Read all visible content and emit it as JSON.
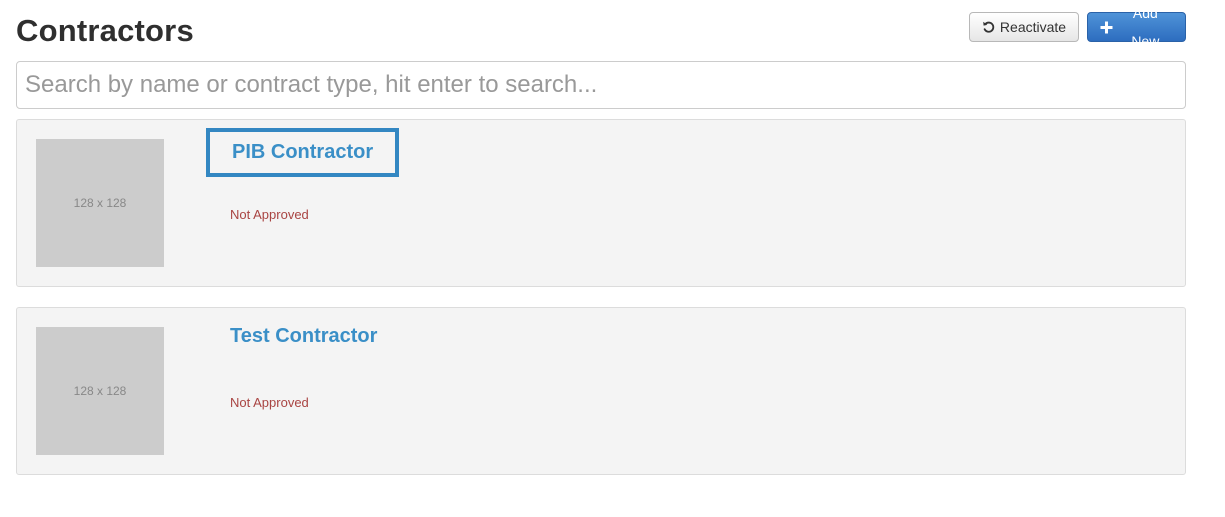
{
  "header": {
    "title": "Contractors",
    "reactivate_label": "Reactivate",
    "reactivate_icon": "undo-icon",
    "add_new_label": "Add New",
    "add_new_icon": "plus-icon"
  },
  "search": {
    "placeholder": "Search by name or contract type, hit enter to search...",
    "value": ""
  },
  "contractors": [
    {
      "name": "PIB Contractor",
      "thumbnail_text": "128 x 128",
      "status": "Not Approved",
      "highlighted": true
    },
    {
      "name": "Test Contractor",
      "thumbnail_text": "128 x 128",
      "status": "Not Approved",
      "highlighted": false
    }
  ],
  "colors": {
    "link": "#3a8fc7",
    "status_not_approved": "#a94442",
    "primary_button": "#337ab7",
    "highlight_border": "#3387c2",
    "card_background": "#f4f4f4"
  }
}
